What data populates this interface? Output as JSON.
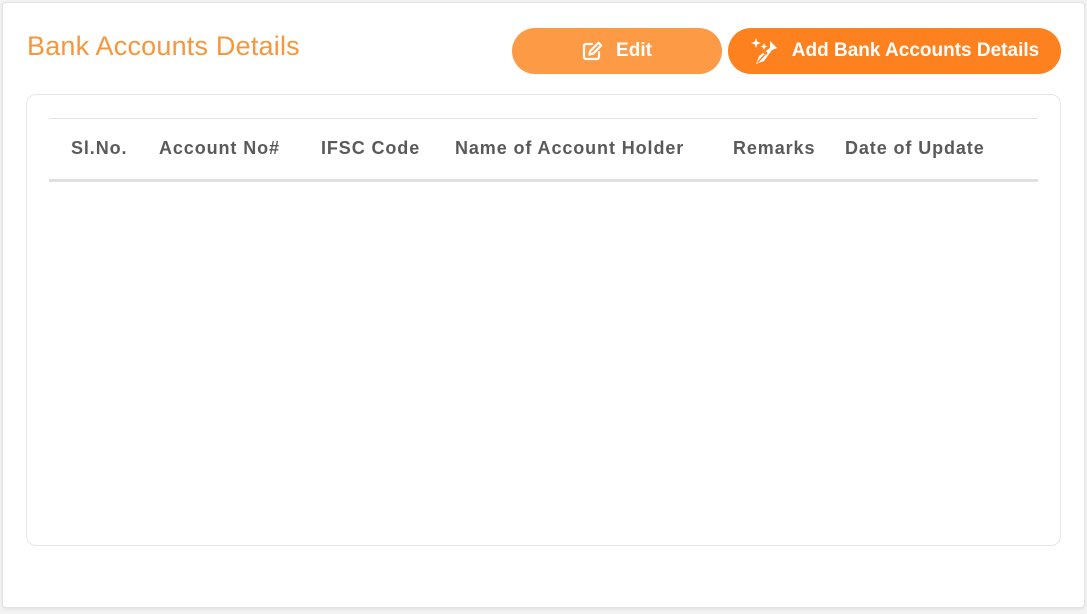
{
  "header": {
    "title": "Bank Accounts Details",
    "edit_label": "Edit",
    "add_label": "Add Bank Accounts Details",
    "edit_icon": "pencil-square-icon",
    "add_icon": "sparkle-pen-icon"
  },
  "table": {
    "columns": [
      "Sl.No.",
      "Account No#",
      "IFSC Code",
      "Name of Account Holder",
      "Remarks",
      "Date of Update"
    ],
    "rows": []
  },
  "colors": {
    "accent": "#f7963a",
    "edit_button": "#fc9a45",
    "add_button": "#fd811f"
  }
}
